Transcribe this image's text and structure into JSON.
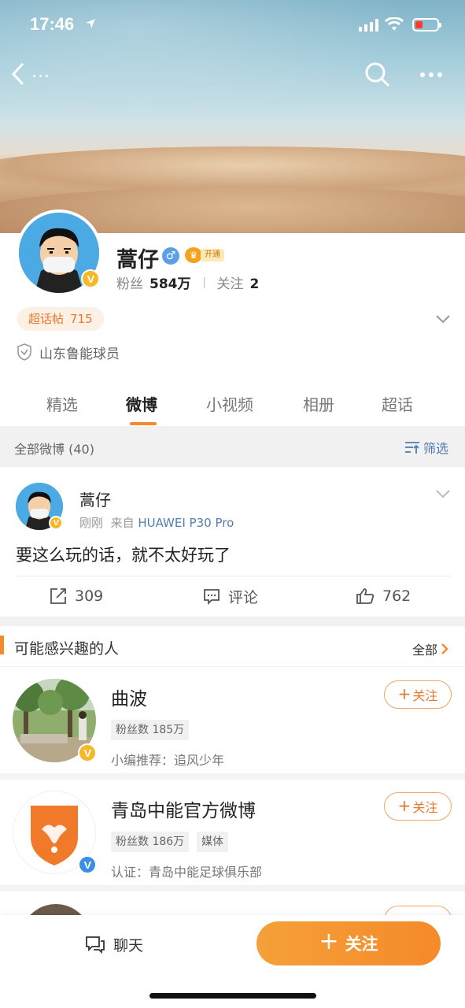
{
  "status_bar": {
    "time": "17:46"
  },
  "nav": {
    "back_suffix": "..."
  },
  "profile": {
    "name": "蒿仔",
    "gender_symbol": "♂",
    "vip_label": "开通",
    "fans_label": "粉丝",
    "fans_value": "584万",
    "follow_label": "关注",
    "follow_value": "2",
    "chaohua_label": "超话帖",
    "chaohua_value": "715",
    "certification": "山东鲁能球员"
  },
  "tabs": [
    {
      "label": "精选"
    },
    {
      "label": "微博"
    },
    {
      "label": "小视频"
    },
    {
      "label": "相册"
    },
    {
      "label": "超话"
    }
  ],
  "weibo_bar": {
    "label": "全部微博 (40)",
    "filter_label": "筛选"
  },
  "post": {
    "author": "蒿仔",
    "time": "刚刚",
    "from_label": "来自",
    "source": "HUAWEI P30 Pro",
    "text": "要这么玩的话，就不太好玩了",
    "repost_count": "309",
    "comment_label": "评论",
    "like_count": "762"
  },
  "recommend": {
    "title": "可能感兴趣的人",
    "all_label": "全部",
    "follow_label": "关注",
    "users": [
      {
        "name": "曲波",
        "tags": [
          "粉丝数 185万"
        ],
        "desc": "小编推荐：追风少年"
      },
      {
        "name": "青岛中能官方微博",
        "tags": [
          "粉丝数 186万",
          "媒体"
        ],
        "desc": "认证：青岛中能足球俱乐部"
      }
    ]
  },
  "bottom": {
    "chat_label": "聊天",
    "follow_label": "关注"
  },
  "colors": {
    "accent": "#f48a2c",
    "link": "#507daf",
    "verified_gold": "#f5b829",
    "verified_blue": "#3b8ee6"
  }
}
